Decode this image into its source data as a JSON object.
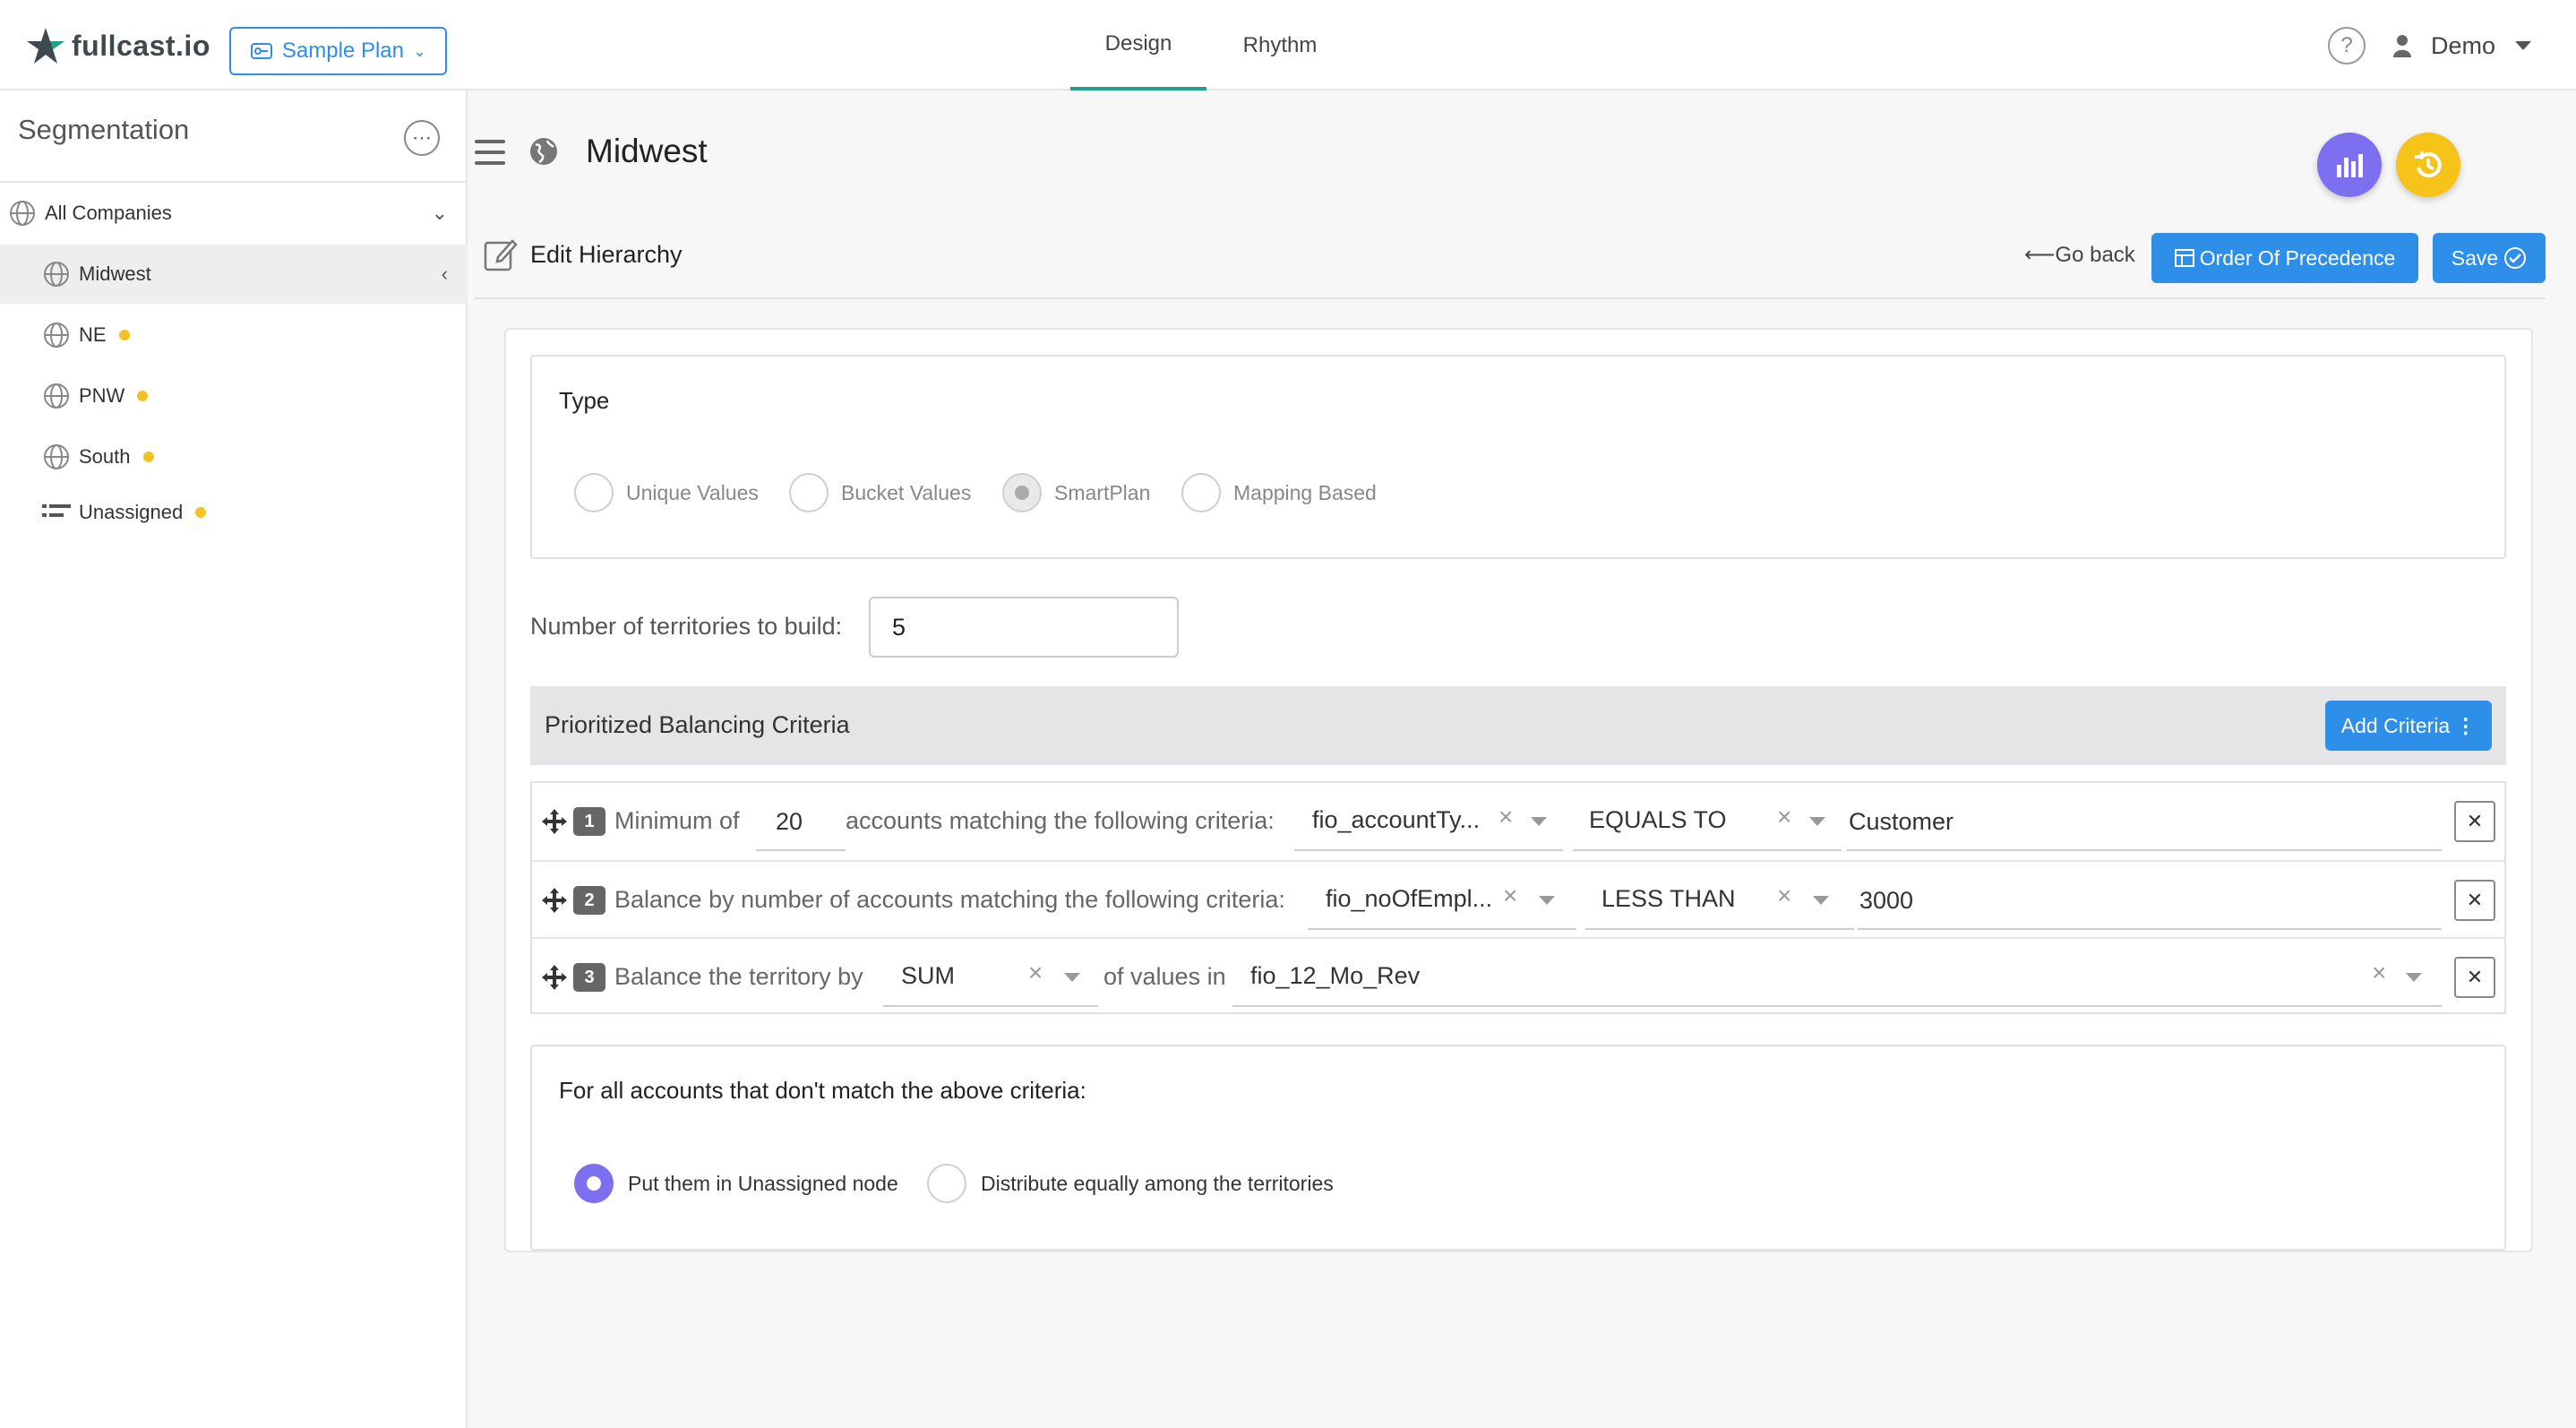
{
  "app": {
    "logo_text": "fullcast.io",
    "plan_label": "Sample Plan"
  },
  "nav": {
    "tabs": [
      {
        "label": "Design",
        "active": true
      },
      {
        "label": "Rhythm",
        "active": false
      }
    ]
  },
  "user": {
    "name": "Demo"
  },
  "sidebar": {
    "title": "Segmentation",
    "root": {
      "label": "All Companies"
    },
    "items": [
      {
        "label": "Midwest",
        "selected": true,
        "dot": false
      },
      {
        "label": "NE",
        "dot": true
      },
      {
        "label": "PNW",
        "dot": true
      },
      {
        "label": "South",
        "dot": true
      },
      {
        "label": "Unassigned",
        "dot": true
      }
    ]
  },
  "header": {
    "node_title": "Midwest",
    "edit_label": "Edit Hierarchy",
    "go_back": "Go back",
    "order_label": "Order Of Precedence",
    "save_label": "Save"
  },
  "type": {
    "title": "Type",
    "options": [
      "Unique Values",
      "Bucket Values",
      "SmartPlan",
      "Mapping Based"
    ],
    "selected": "SmartPlan"
  },
  "territories": {
    "label": "Number of territories to build:",
    "value": "5"
  },
  "criteria": {
    "title": "Prioritized Balancing Criteria",
    "add_label": "Add Criteria",
    "rows": [
      {
        "num": "1",
        "prefix": "Minimum of",
        "count": "20",
        "text": "accounts matching the following criteria:",
        "field": "fio_accountTy...",
        "operator": "EQUALS TO",
        "value": "Customer"
      },
      {
        "num": "2",
        "text": "Balance by number of accounts matching the following criteria:",
        "field": "fio_noOfEmpl...",
        "operator": "LESS THAN",
        "value": "3000"
      },
      {
        "num": "3",
        "text": "Balance the territory by",
        "agg": "SUM",
        "mid": "of values in",
        "field": "fio_12_Mo_Rev"
      }
    ]
  },
  "fallback": {
    "title": "For all accounts that don't match the above criteria:",
    "options": [
      "Put them in Unassigned node",
      "Distribute equally among the territories"
    ],
    "selected": "Put them in Unassigned node"
  },
  "colors": {
    "primary": "#2d8fe8",
    "accent_purple": "#7c6ff0",
    "accent_yellow": "#f6c318",
    "tab_underline": "#23a08c",
    "dot": "#f2c225"
  }
}
